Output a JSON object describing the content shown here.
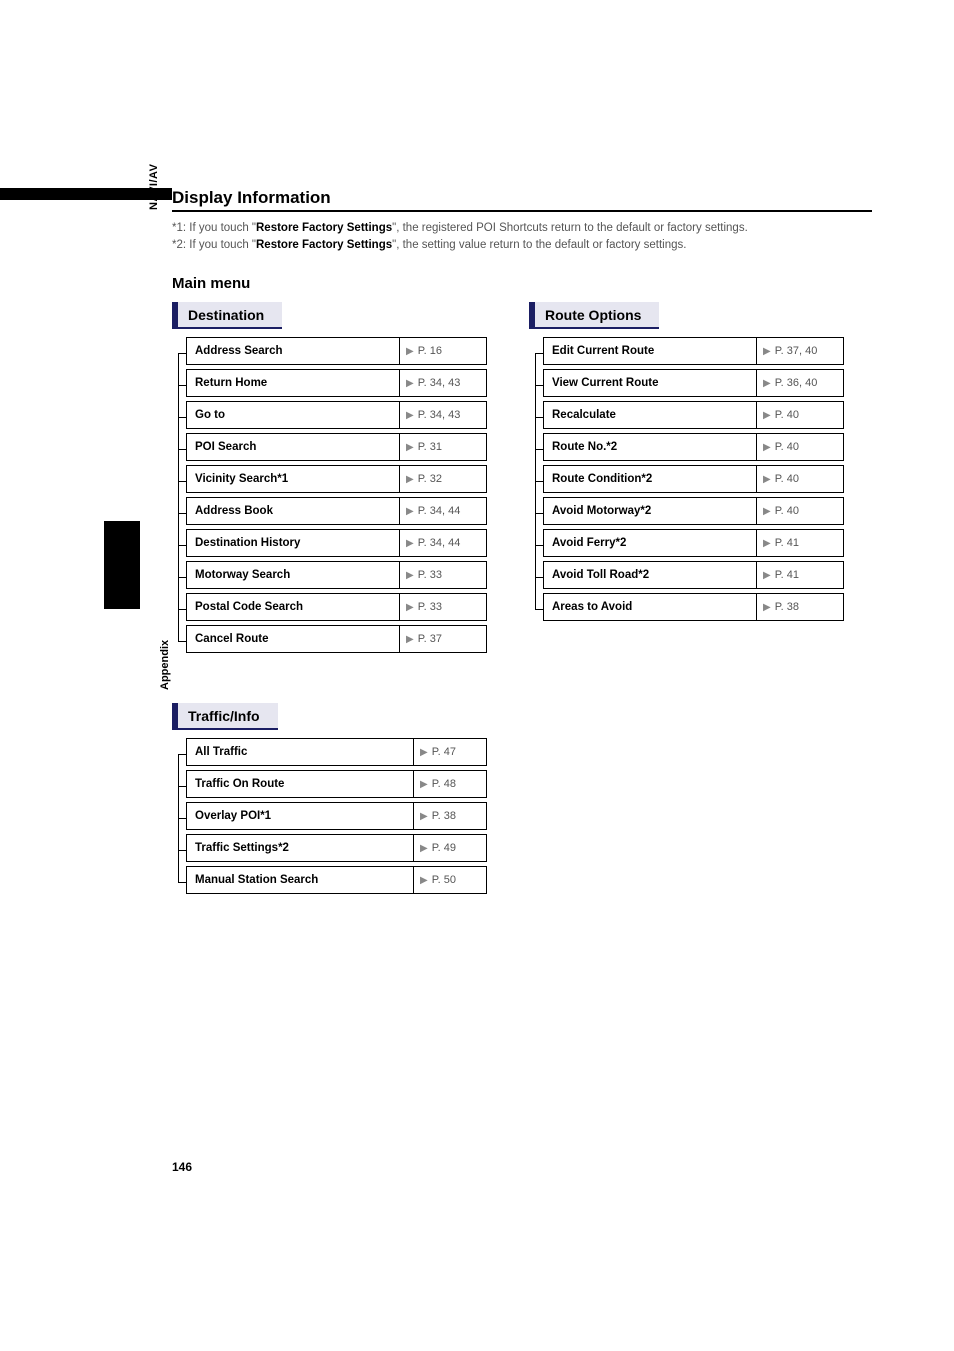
{
  "sideLabels": {
    "naviav": "NAVI/AV",
    "appendix": "Appendix"
  },
  "sectionTitle": "Display Information",
  "notes": {
    "n1_prefix": "*1: If you touch \"",
    "n1_bold": "Restore Factory Settings",
    "n1_suffix": "\", the registered POI Shortcuts return to the default or factory settings.",
    "n2_prefix": "*2: If you touch \"",
    "n2_bold": "Restore Factory Settings",
    "n2_suffix": "\", the setting value return to the default or factory settings."
  },
  "subsectionTitle": "Main menu",
  "destination": {
    "header": "Destination",
    "items": [
      {
        "label": "Address Search",
        "page": "P. 16"
      },
      {
        "label": "Return Home",
        "page": "P. 34, 43"
      },
      {
        "label": "Go to",
        "page": "P. 34, 43"
      },
      {
        "label": "POI Search",
        "page": "P. 31"
      },
      {
        "label": "Vicinity Search*1",
        "page": "P. 32"
      },
      {
        "label": "Address Book",
        "page": "P. 34, 44"
      },
      {
        "label": "Destination History",
        "page": "P. 34, 44"
      },
      {
        "label": "Motorway Search",
        "page": "P. 33"
      },
      {
        "label": "Postal Code Search",
        "page": "P. 33"
      },
      {
        "label": "Cancel Route",
        "page": "P. 37"
      }
    ]
  },
  "routeOptions": {
    "header": "Route Options",
    "items": [
      {
        "label": "Edit Current Route",
        "page": "P. 37, 40"
      },
      {
        "label": "View Current Route",
        "page": "P. 36, 40"
      },
      {
        "label": "Recalculate",
        "page": "P. 40"
      },
      {
        "label": "Route No.*2",
        "page": "P. 40"
      },
      {
        "label": "Route Condition*2",
        "page": "P. 40"
      },
      {
        "label": "Avoid Motorway*2",
        "page": "P. 40"
      },
      {
        "label": "Avoid Ferry*2",
        "page": "P. 41"
      },
      {
        "label": "Avoid Toll Road*2",
        "page": "P. 41"
      },
      {
        "label": "Areas to Avoid",
        "page": "P. 38"
      }
    ]
  },
  "trafficInfo": {
    "header": "Traffic/Info",
    "items": [
      {
        "label": "All Traffic",
        "page": "P. 47"
      },
      {
        "label": "Traffic On Route",
        "page": "P. 48"
      },
      {
        "label": "Overlay POI*1",
        "page": "P. 38"
      },
      {
        "label": "Traffic Settings*2",
        "page": "P. 49"
      },
      {
        "label": "Manual Station Search",
        "page": "P. 50"
      }
    ]
  },
  "pageNumber": "146"
}
